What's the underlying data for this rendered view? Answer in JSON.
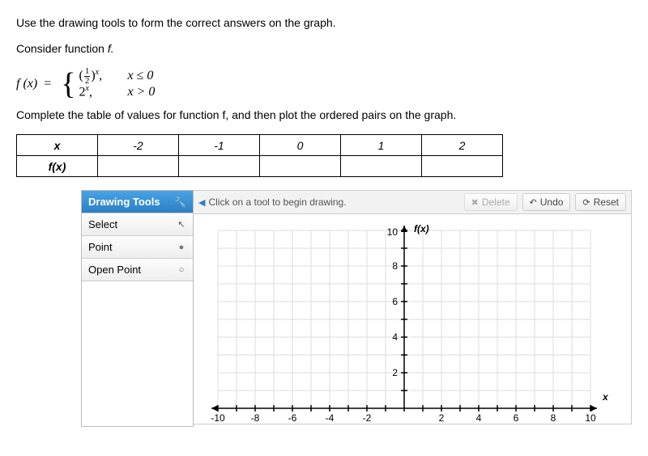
{
  "instructions": {
    "line1": "Use the drawing tools to form the correct answers on the graph.",
    "line2_prefix": "Consider function ",
    "line2_fn": "f.",
    "line3": "Complete the table of values for function f, and then plot the ordered pairs on the graph."
  },
  "piecewise": {
    "lhs": "f (x)",
    "equals": "=",
    "row1_expr_open": "(",
    "row1_frac_num": "1",
    "row1_frac_den": "2",
    "row1_expr_close": ")",
    "row1_sup": "x",
    "row1_comma": ",",
    "row1_cond": "x ≤ 0",
    "row2_base": "2",
    "row2_sup": "x",
    "row2_comma": ",",
    "row2_cond": "x > 0"
  },
  "table": {
    "header_x": "x",
    "header_fx": "f(x)",
    "cols": [
      "-2",
      "-1",
      "0",
      "1",
      "2"
    ],
    "vals": [
      "",
      "",
      "",
      "",
      ""
    ]
  },
  "tools": {
    "title": "Drawing Tools",
    "items": [
      {
        "label": "Select",
        "icon": "↖"
      },
      {
        "label": "Point",
        "icon": "●"
      },
      {
        "label": "Open Point",
        "icon": "○"
      }
    ]
  },
  "bar": {
    "hint": "Click on a tool to begin drawing.",
    "delete": "Delete",
    "undo": "Undo",
    "reset": "Reset"
  },
  "graph": {
    "ylabel": "f(x)",
    "xlabel": "x",
    "xticks": [
      "-10",
      "-8",
      "-6",
      "-4",
      "-2",
      "2",
      "4",
      "6",
      "8",
      "10"
    ],
    "yticks": [
      "2",
      "4",
      "6",
      "8",
      "10"
    ]
  },
  "chart_data": {
    "type": "scatter",
    "title": "",
    "xlabel": "x",
    "ylabel": "f(x)",
    "xlim": [
      -10,
      10
    ],
    "ylim": [
      0,
      10
    ],
    "series": [
      {
        "name": "points",
        "x": [],
        "y": []
      }
    ]
  }
}
